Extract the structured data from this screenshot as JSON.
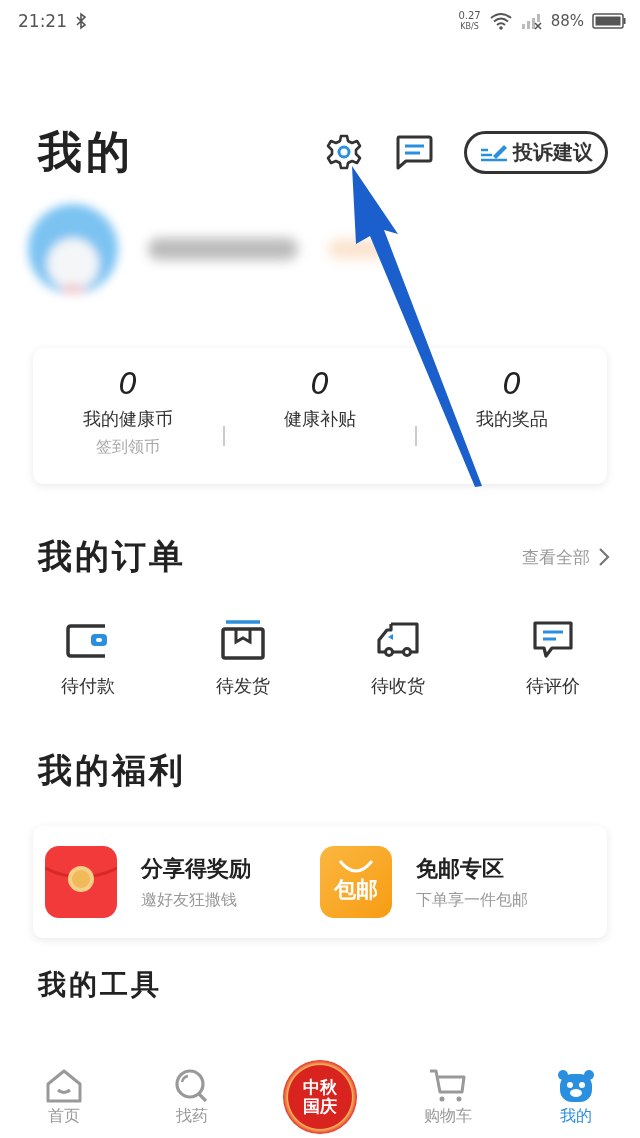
{
  "status_bar": {
    "time": "21:21",
    "speed": "0.27",
    "speed_unit": "KB/S",
    "battery": "88%"
  },
  "header": {
    "title": "我的",
    "feedback_button": "投诉建议"
  },
  "stats": [
    {
      "value": "0",
      "label": "我的健康币",
      "sub": "签到领币"
    },
    {
      "value": "0",
      "label": "健康补贴"
    },
    {
      "value": "0",
      "label": "我的奖品"
    }
  ],
  "orders": {
    "title": "我的订单",
    "view_all": "查看全部",
    "items": [
      {
        "kind": "wallet",
        "label": "待付款"
      },
      {
        "kind": "box",
        "label": "待发货"
      },
      {
        "kind": "truck",
        "label": "待收货"
      },
      {
        "kind": "chat",
        "label": "待评价"
      }
    ]
  },
  "welfare": {
    "title": "我的福利",
    "items": [
      {
        "kind": "red-envelope",
        "title": "分享得奖励",
        "subtitle": "邀好友狂撒钱"
      },
      {
        "kind": "free-shipping",
        "badge": "包邮",
        "title": "免邮专区",
        "subtitle": "下单享一件包邮"
      }
    ]
  },
  "tools": {
    "title": "我的工具"
  },
  "tab_bar": [
    {
      "kind": "home",
      "label": "首页",
      "selected": false
    },
    {
      "kind": "search",
      "label": "找药",
      "selected": false
    },
    {
      "kind": "promo",
      "badge": "中秋国庆",
      "selected": false
    },
    {
      "kind": "cart",
      "label": "购物车",
      "selected": false
    },
    {
      "kind": "bear",
      "label": "我的",
      "selected": true
    }
  ]
}
